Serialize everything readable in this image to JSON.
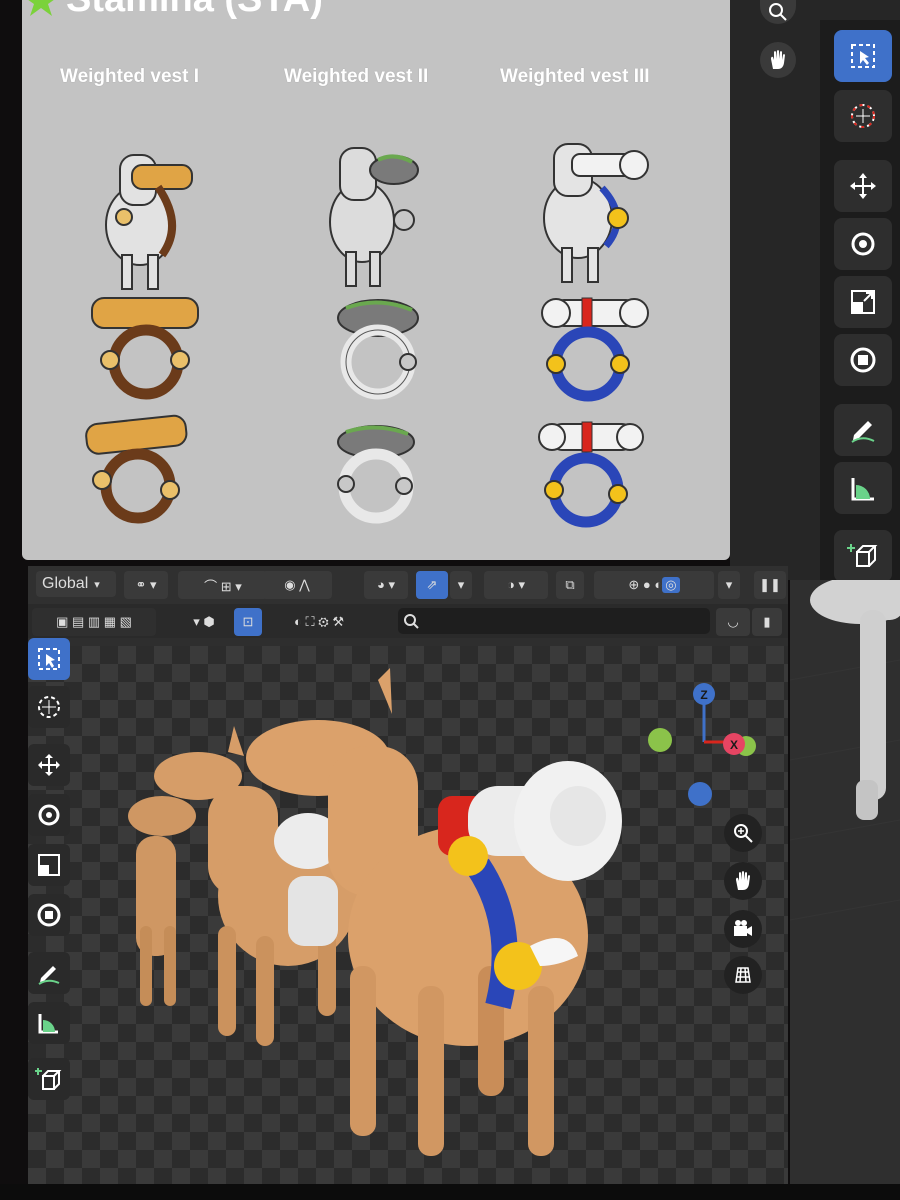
{
  "reference_sheet": {
    "title": "Stamina (STA)",
    "columns": [
      {
        "label": "Weighted vest I",
        "color": "#d9a441",
        "ring": "#6b3b1a"
      },
      {
        "label": "Weighted vest II",
        "color": "#8a8a8a",
        "ring": "#e8e8e8"
      },
      {
        "label": "Weighted vest III",
        "color": "#f2f2f2",
        "ring": "#2a46b8"
      }
    ]
  },
  "viewport": {
    "transform_orientation": "Global",
    "colors": {
      "accent": "#3f71c9",
      "model": "#d9a06a",
      "vest_white": "#ececec",
      "vest_blue": "#2a46b8",
      "vest_red": "#d8261d",
      "vest_yellow": "#f3c21b"
    },
    "gizmo": {
      "z": "Z",
      "x": "X"
    }
  },
  "icons": {
    "select_box": "select-box-icon",
    "cursor": "cursor-icon",
    "move": "move-icon",
    "rotate": "rotate-icon",
    "scale": "scale-icon",
    "transform": "transform-icon",
    "annotate": "annotate-icon",
    "measure": "measure-icon",
    "add_cube": "add-cube-icon",
    "zoom": "zoom-icon",
    "hand": "hand-icon",
    "camera": "camera-icon",
    "grid": "grid-icon"
  }
}
